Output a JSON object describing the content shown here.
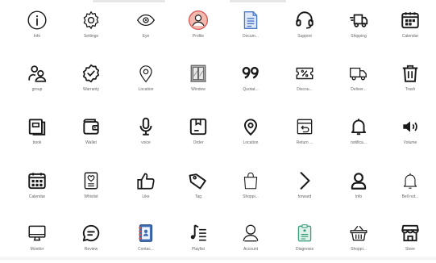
{
  "icons": [
    {
      "label": "Info",
      "icon": "info-icon"
    },
    {
      "label": "Settings",
      "icon": "gear-icon"
    },
    {
      "label": "Eye",
      "icon": "eye-icon"
    },
    {
      "label": "Profile",
      "icon": "profile-icon"
    },
    {
      "label": "Docum...",
      "icon": "document-icon"
    },
    {
      "label": "Support",
      "icon": "headset-icon"
    },
    {
      "label": "Shipping",
      "icon": "truck-fast-icon"
    },
    {
      "label": "Calendar",
      "icon": "calendar-icon"
    },
    {
      "label": "group",
      "icon": "group-icon"
    },
    {
      "label": "Warranty",
      "icon": "warranty-badge-icon"
    },
    {
      "label": "Location",
      "icon": "location-pin-icon"
    },
    {
      "label": "Window",
      "icon": "window-icon"
    },
    {
      "label": "Quotat...",
      "icon": "quotation-icon"
    },
    {
      "label": "Discou...",
      "icon": "discount-ticket-icon"
    },
    {
      "label": "Deliver...",
      "icon": "delivery-truck-icon"
    },
    {
      "label": "Trash",
      "icon": "trash-icon"
    },
    {
      "label": "book",
      "icon": "book-icon"
    },
    {
      "label": "Wallet",
      "icon": "wallet-icon"
    },
    {
      "label": "voice",
      "icon": "microphone-icon"
    },
    {
      "label": "Order",
      "icon": "order-box-icon"
    },
    {
      "label": "Location",
      "icon": "location-circle-icon"
    },
    {
      "label": "Return ...",
      "icon": "return-box-icon"
    },
    {
      "label": "notifica...",
      "icon": "bell-icon"
    },
    {
      "label": "Volume",
      "icon": "volume-icon"
    },
    {
      "label": "Calendar",
      "icon": "calendar-grid-icon"
    },
    {
      "label": "Whislist",
      "icon": "wishlist-icon"
    },
    {
      "label": "Like",
      "icon": "thumbs-up-icon"
    },
    {
      "label": "Tag",
      "icon": "tag-icon"
    },
    {
      "label": "Shoppi...",
      "icon": "shopping-bag-icon"
    },
    {
      "label": "forward",
      "icon": "chevron-right-icon"
    },
    {
      "label": "Info",
      "icon": "user-outline-icon"
    },
    {
      "label": "Bell not...",
      "icon": "bell-outline-icon"
    },
    {
      "label": "Monitor",
      "icon": "monitor-icon"
    },
    {
      "label": "Review",
      "icon": "review-chat-icon"
    },
    {
      "label": "Contac...",
      "icon": "contact-book-icon"
    },
    {
      "label": "Playlist",
      "icon": "playlist-icon"
    },
    {
      "label": "Account",
      "icon": "account-icon"
    },
    {
      "label": "Diagnosis",
      "icon": "diagnosis-clipboard-icon"
    },
    {
      "label": "Shoppi...",
      "icon": "shopping-basket-icon"
    },
    {
      "label": "Store",
      "icon": "store-icon"
    }
  ],
  "colors": {
    "stroke": "#1a1a1a",
    "label": "#666666",
    "profile_bg": "#f3b8b0",
    "profile_ring": "#d9534f",
    "doc_blue": "#4a78c8",
    "doc_light": "#dfe8f7",
    "window_frame": "#6b6b6b",
    "contact_blue": "#3f6fb6",
    "contact_red": "#d9534f",
    "diagnosis_green": "#3a9d7a",
    "diagnosis_light": "#dff1ea"
  }
}
